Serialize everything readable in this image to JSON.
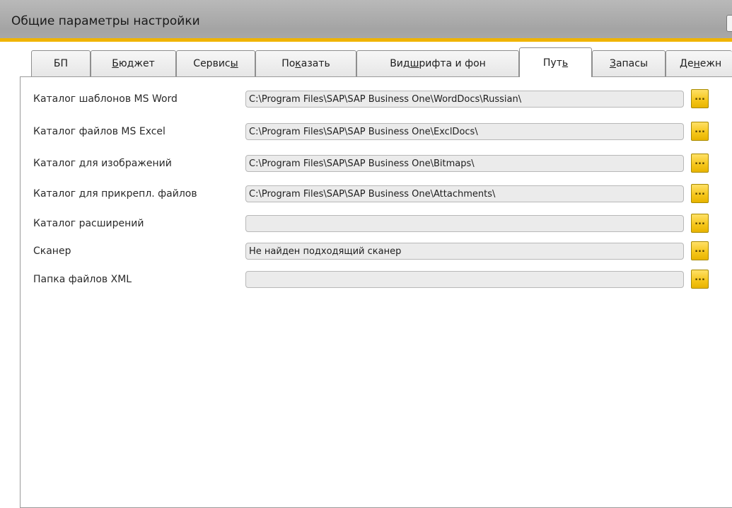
{
  "window": {
    "title": "Общие параметры настройки"
  },
  "tabs": [
    {
      "pre": "БП",
      "mnemonic": "",
      "post": ""
    },
    {
      "pre": "",
      "mnemonic": "Б",
      "post": "юджет"
    },
    {
      "pre": "Сервис",
      "mnemonic": "ы",
      "post": ""
    },
    {
      "pre": "По",
      "mnemonic": "к",
      "post": "азать"
    },
    {
      "pre": "Вид ",
      "mnemonic": "ш",
      "post": "рифта и фон"
    },
    {
      "pre": "Пут",
      "mnemonic": "ь",
      "post": ""
    },
    {
      "pre": "",
      "mnemonic": "З",
      "post": "апасы"
    },
    {
      "pre": "Де",
      "mnemonic": "н",
      "post": "ежн"
    }
  ],
  "active_tab": "Путь",
  "rows": [
    {
      "label": "Каталог шаблонов MS Word",
      "value": "C:\\Program Files\\SAP\\SAP Business One\\WordDocs\\Russian\\",
      "button": "..."
    },
    {
      "label": "Каталог файлов MS Excel",
      "value": "C:\\Program Files\\SAP\\SAP Business One\\ExclDocs\\",
      "button": "..."
    },
    {
      "label": "Каталог для изображений",
      "value": "C:\\Program Files\\SAP\\SAP Business One\\Bitmaps\\",
      "button": "..."
    },
    {
      "label": "Каталог для прикрепл. файлов",
      "value": "C:\\Program Files\\SAP\\SAP Business One\\Attachments\\",
      "button": "..."
    },
    {
      "label": "Каталог расширений",
      "value": "",
      "button": "..."
    },
    {
      "label": "Сканер",
      "value": "Не найден подходящий сканер",
      "button": "..."
    },
    {
      "label": "Папка файлов XML",
      "value": "",
      "button": "..."
    }
  ],
  "colors": {
    "accent": "#f0b400",
    "titlebar": "#a8a8a8",
    "browse_button": "#f5c518",
    "field_background": "#ebebeb"
  }
}
